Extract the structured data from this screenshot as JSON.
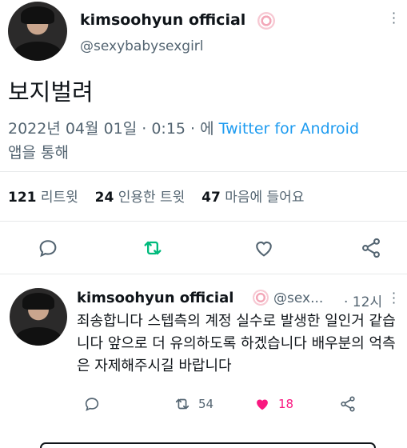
{
  "tweet": {
    "display_name": "kimsoohyun official",
    "handle": "@sexybabysexgirl",
    "text": "보지벌려",
    "timestamp": "2022년 04월 01일 · 0:15 · 에",
    "client_link": "Twitter for Android",
    "client_suffix": "앱을 통해",
    "retweets_count": "121",
    "retweets_label": "리트윗",
    "quotes_count": "24",
    "quotes_label": "인용한 트윗",
    "likes_count": "47",
    "likes_label": "마음에 들어요"
  },
  "reply": {
    "display_name": "kimsoohyun official",
    "handle": "@sex...",
    "time": "· 12시",
    "text": "죄송합니다 스텝측의 계정 실수로 발생한 일인거 같습니다 앞으로 더 유의하도록 하겠습니다 배우분의 억측은 자제해주시길 바랍니다",
    "retweets": "54",
    "likes": "18"
  },
  "icons": {
    "reply": "reply-icon",
    "retweet": "retweet-icon",
    "like": "heart-icon",
    "share": "share-icon",
    "more": "more-icon",
    "verified": "verified-badge-icon"
  },
  "colors": {
    "retweet_active": "#00ba7c",
    "like_active": "#f91880",
    "link": "#1d9bf0",
    "muted": "#536471"
  }
}
